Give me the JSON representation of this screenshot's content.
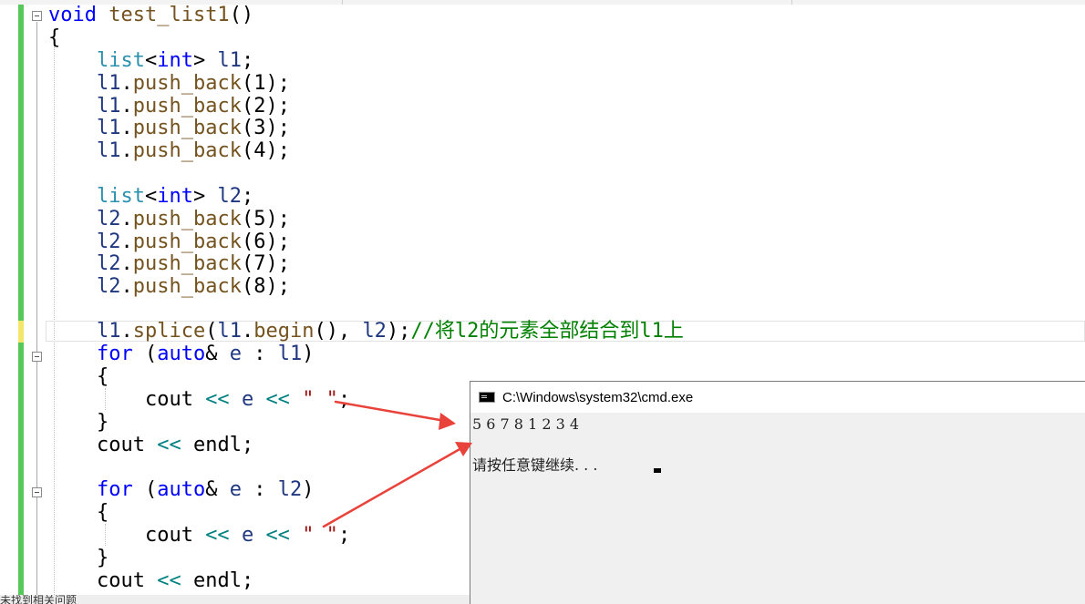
{
  "editor": {
    "lines": {
      "l01": {
        "a": "void",
        "b": " test_list1",
        "c": "()"
      },
      "l02": {
        "a": "{"
      },
      "l03": {
        "a": "    ",
        "b": "list",
        "c": "<",
        "d": "int",
        "e": "> ",
        "f": "l1",
        "g": ";"
      },
      "l04": {
        "a": "    ",
        "b": "l1",
        ".": ".",
        "c": "push_back",
        "d": "(1);"
      },
      "l05": {
        "a": "    ",
        "b": "l1",
        ".": ".",
        "c": "push_back",
        "d": "(2);"
      },
      "l06": {
        "a": "    ",
        "b": "l1",
        ".": ".",
        "c": "push_back",
        "d": "(3);"
      },
      "l07": {
        "a": "    ",
        "b": "l1",
        ".": ".",
        "c": "push_back",
        "d": "(4);"
      },
      "l09": {
        "a": "    ",
        "b": "list",
        "c": "<",
        "d": "int",
        "e": "> ",
        "f": "l2",
        "g": ";"
      },
      "l10": {
        "a": "    ",
        "b": "l2",
        ".": ".",
        "c": "push_back",
        "d": "(5);"
      },
      "l11": {
        "a": "    ",
        "b": "l2",
        ".": ".",
        "c": "push_back",
        "d": "(6);"
      },
      "l12": {
        "a": "    ",
        "b": "l2",
        ".": ".",
        "c": "push_back",
        "d": "(7);"
      },
      "l13": {
        "a": "    ",
        "b": "l2",
        ".": ".",
        "c": "push_back",
        "d": "(8);"
      },
      "l15": {
        "a": "    ",
        "b": "l1",
        ".": ".",
        "c": "splice",
        "d": "(",
        "e": "l1",
        ".2": ".",
        "f": "begin",
        "g": "(), ",
        "h": "l2",
        "i": ");",
        "j": "//将l2的元素全部结合到l1上"
      },
      "l16": {
        "a": "    ",
        "b": "for",
        "c": " (",
        "d": "auto",
        "e": "& ",
        "f": "e",
        "g": " : ",
        "h": "l1",
        "i": ")"
      },
      "l17": {
        "a": "    {"
      },
      "l18": {
        "a": "        cout ",
        "b": "<<",
        "c": " ",
        "d": "e",
        "e": " ",
        "f": "<<",
        "g": " ",
        "h": "\" \"",
        "i": ";"
      },
      "l19": {
        "a": "    }"
      },
      "l20": {
        "a": "    cout ",
        "b": "<<",
        "c": " endl;"
      },
      "l22": {
        "a": "    ",
        "b": "for",
        "c": " (",
        "d": "auto",
        "e": "& ",
        "f": "e",
        "g": " : ",
        "h": "l2",
        "i": ")"
      },
      "l23": {
        "a": "    {"
      },
      "l24": {
        "a": "        cout ",
        "b": "<<",
        "c": " ",
        "d": "e",
        "e": " ",
        "f": "<<",
        "g": " ",
        "h": "\" \"",
        "i": ";"
      },
      "l25": {
        "a": "    }"
      },
      "l26": {
        "a": "    cout ",
        "b": "<<",
        "c": " endl;"
      }
    }
  },
  "console": {
    "title": "C:\\Windows\\system32\\cmd.exe",
    "output_line": "5 6 7 8 1 2 3 4",
    "prompt": "请按任意键继续. . . "
  },
  "statusbar": {
    "text": "未找到相关问题"
  },
  "colors": {
    "keyword": "#0000ff",
    "type": "#2b91af",
    "function": "#74531f",
    "variable": "#1f377f",
    "operator": "#008080",
    "string": "#a31515",
    "comment": "#008000",
    "change_bar": "#57c95a",
    "arrow": "#e8423a"
  }
}
